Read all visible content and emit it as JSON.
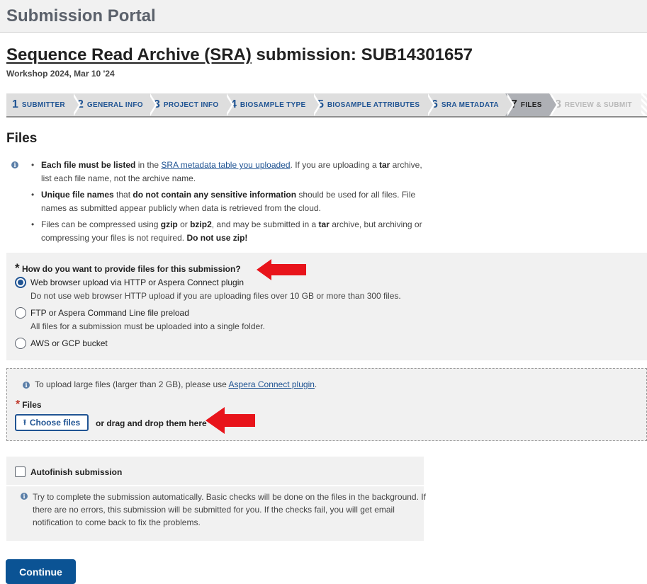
{
  "portal": {
    "title": "Submission Portal"
  },
  "page": {
    "title_link": "Sequence Read Archive (SRA)",
    "title_rest": " submission: SUB14301657",
    "subtitle": "Workshop 2024, Mar 10 '24"
  },
  "steps": [
    {
      "num": "1",
      "label": "SUBMITTER",
      "state": "done"
    },
    {
      "num": "2",
      "label": "GENERAL INFO",
      "state": "done"
    },
    {
      "num": "3",
      "label": "PROJECT INFO",
      "state": "done"
    },
    {
      "num": "4",
      "label": "BIOSAMPLE TYPE",
      "state": "done"
    },
    {
      "num": "5",
      "label": "BIOSAMPLE ATTRIBUTES",
      "state": "done"
    },
    {
      "num": "6",
      "label": "SRA METADATA",
      "state": "done"
    },
    {
      "num": "7",
      "label": "FILES",
      "state": "active"
    },
    {
      "num": "8",
      "label": "REVIEW & SUBMIT",
      "state": "disabled"
    }
  ],
  "files_section": {
    "title": "Files",
    "info_icon": "info-icon",
    "bullet1": {
      "b1": "Each file must be listed",
      "t1": " in the ",
      "link": "SRA metadata table you uploaded",
      "t2": ". If you are uploading a ",
      "b2": "tar",
      "t3": " archive, list each file name, not the archive name."
    },
    "bullet2": {
      "b1": "Unique file names",
      "t1": " that ",
      "b2": "do not contain any sensitive information",
      "t2": " should be used for all files. File names as submitted appear publicly when data is retrieved from the cloud."
    },
    "bullet3": {
      "t1": "Files can be compressed using ",
      "b1": "gzip",
      "t2": " or ",
      "b2": "bzip2",
      "t3": ", and may be submitted in a ",
      "b3": "tar",
      "t4": " archive, but archiving or compressing your files is not required. ",
      "b4": "Do not use zip!"
    }
  },
  "upload_method": {
    "required_marker": "*",
    "question": "How do you want to provide files for this submission?",
    "options": [
      {
        "label": "Web browser upload via HTTP or Aspera Connect plugin",
        "hint": "Do not use web browser HTTP upload if you are uploading files over 10 GB or more than 300 files.",
        "checked": true
      },
      {
        "label": "FTP or Aspera Command Line file preload",
        "hint": "All files for a submission must be uploaded into a single folder.",
        "checked": false
      },
      {
        "label": "AWS or GCP bucket",
        "hint": "",
        "checked": false
      }
    ]
  },
  "upload": {
    "info_text": "To upload large files (larger than 2 GB), please use ",
    "info_link": "Aspera Connect plugin",
    "info_end": ".",
    "required_marker": "*",
    "files_label": "Files",
    "choose_button": "Choose files",
    "upload_icon": "upload-icon",
    "drag_text": "or drag and drop them here"
  },
  "autofinish": {
    "label": "Autofinish submission",
    "checked": false,
    "info": "Try to complete the submission automatically. Basic checks will be done on the files in the background. If there are no errors, this submission will be submitted for you. If the checks fail, you will get email notification to come back to fix the problems."
  },
  "continue_button": "Continue",
  "colors": {
    "accent": "#205493",
    "continue_bg": "#0b5394",
    "panel_bg": "#f1f1f1",
    "annotation_arrow": "#e8141b",
    "files_required_star": "#c0392b"
  }
}
